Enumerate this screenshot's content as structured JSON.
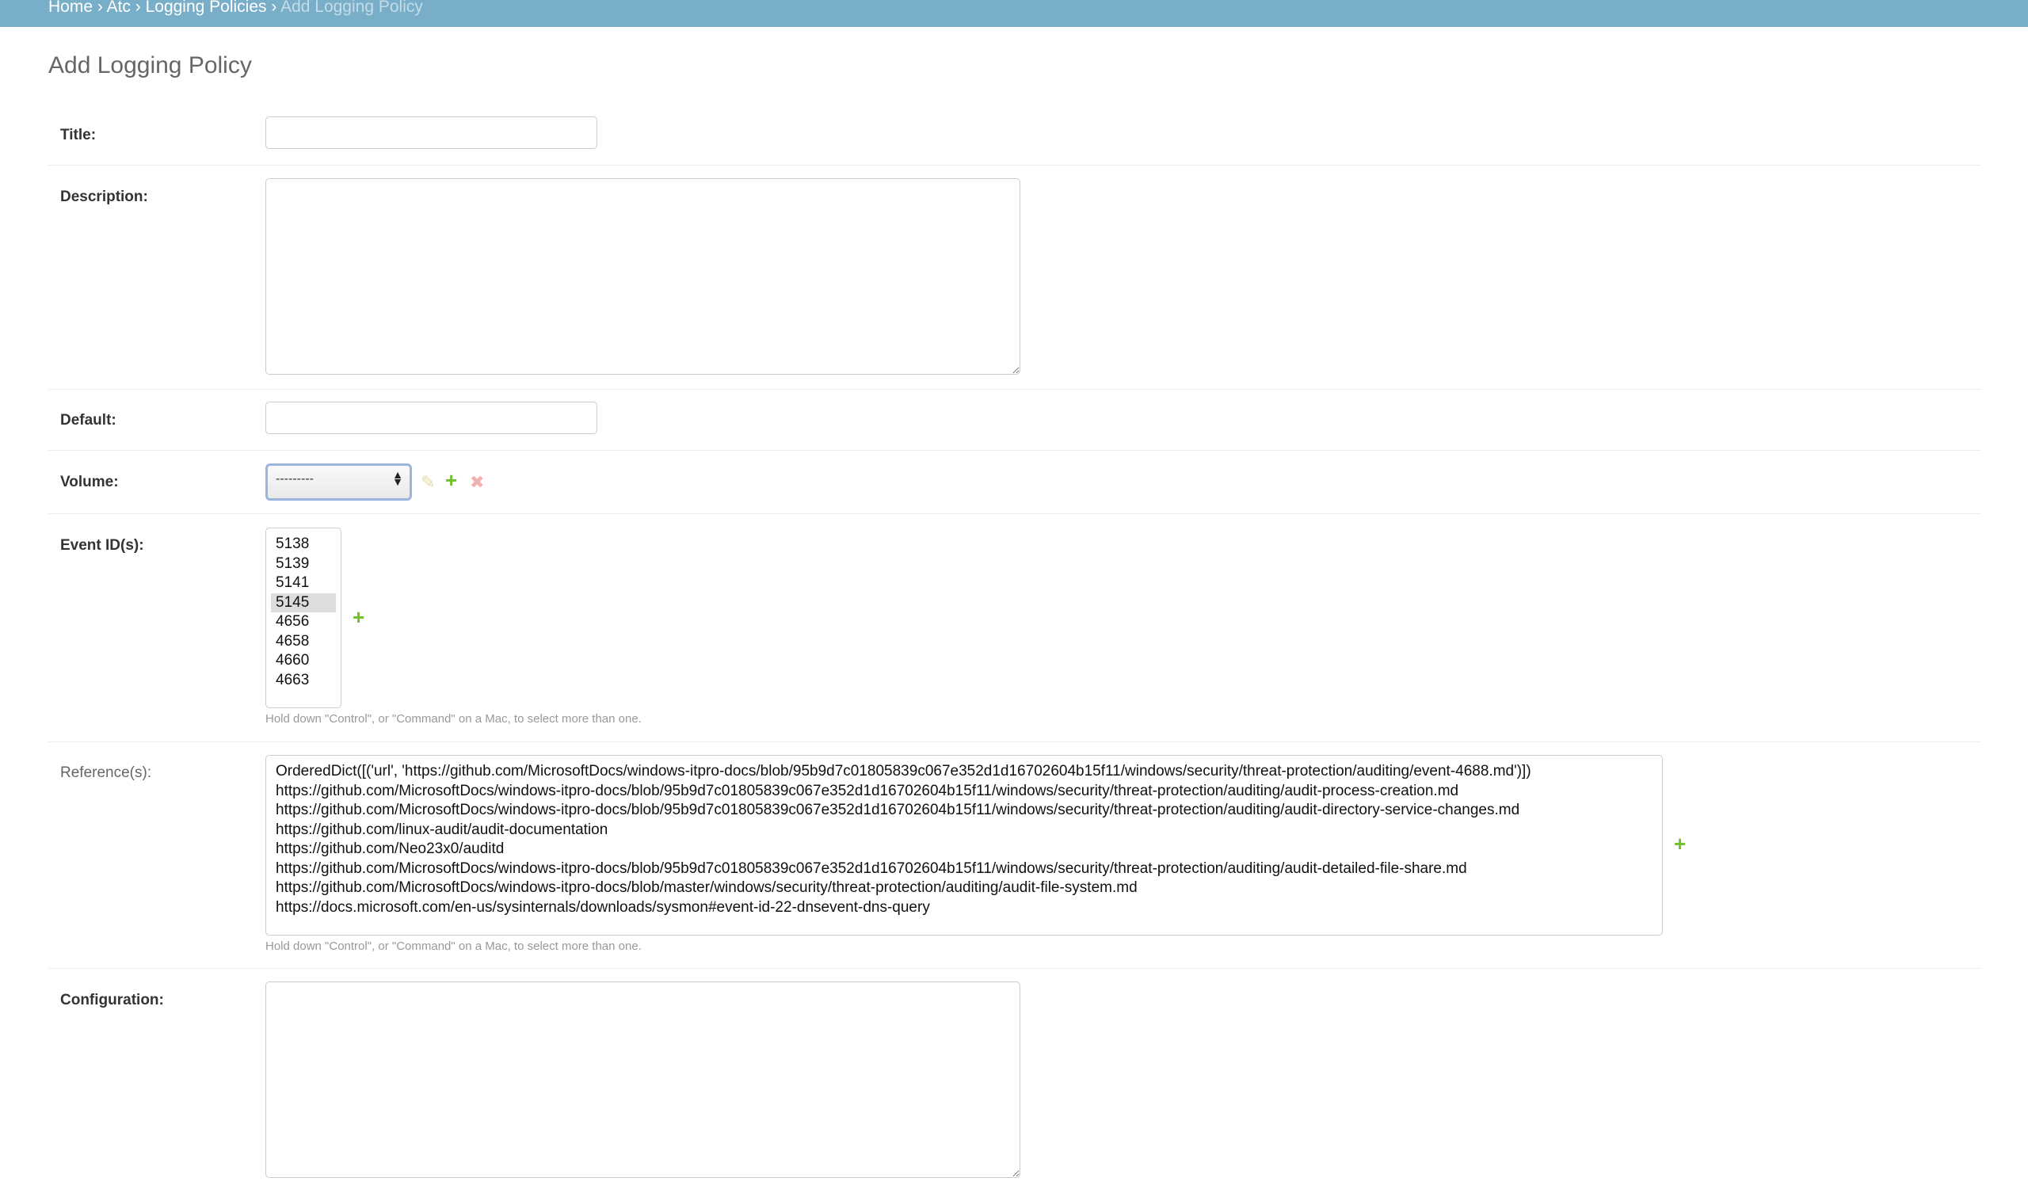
{
  "breadcrumbs": {
    "home": "Home",
    "app": "Atc",
    "model": "Logging Policies",
    "current": "Add Logging Policy",
    "separator": "›"
  },
  "page": {
    "title": "Add Logging Policy"
  },
  "form": {
    "title": {
      "label": "Title:",
      "value": ""
    },
    "description": {
      "label": "Description:",
      "value": ""
    },
    "default": {
      "label": "Default:",
      "value": ""
    },
    "volume": {
      "label": "Volume:",
      "selected": "---------"
    },
    "event_ids": {
      "label": "Event ID(s):",
      "options": [
        "5138",
        "5139",
        "5141",
        "5145",
        "4656",
        "4658",
        "4660",
        "4663"
      ],
      "selected": "5145",
      "help": "Hold down \"Control\", or \"Command\" on a Mac, to select more than one."
    },
    "references": {
      "label": "Reference(s):",
      "options": [
        "OrderedDict([('url', 'https://github.com/MicrosoftDocs/windows-itpro-docs/blob/95b9d7c01805839c067e352d1d16702604b15f11/windows/security/threat-protection/auditing/event-4688.md')])",
        "https://github.com/MicrosoftDocs/windows-itpro-docs/blob/95b9d7c01805839c067e352d1d16702604b15f11/windows/security/threat-protection/auditing/audit-process-creation.md",
        "https://github.com/MicrosoftDocs/windows-itpro-docs/blob/95b9d7c01805839c067e352d1d16702604b15f11/windows/security/threat-protection/auditing/audit-directory-service-changes.md",
        "https://github.com/linux-audit/audit-documentation",
        "https://github.com/Neo23x0/auditd",
        "https://github.com/MicrosoftDocs/windows-itpro-docs/blob/95b9d7c01805839c067e352d1d16702604b15f11/windows/security/threat-protection/auditing/audit-detailed-file-share.md",
        "https://github.com/MicrosoftDocs/windows-itpro-docs/blob/master/windows/security/threat-protection/auditing/audit-file-system.md",
        "https://docs.microsoft.com/en-us/sysinternals/downloads/sysmon#event-id-22-dnsevent-dns-query"
      ],
      "help": "Hold down \"Control\", or \"Command\" on a Mac, to select more than one."
    },
    "configuration": {
      "label": "Configuration:",
      "value": ""
    }
  },
  "icons": {
    "change": "pencil-icon",
    "add": "plus-icon",
    "delete": "cross-icon"
  },
  "colors": {
    "header_bg": "#79aec8",
    "add_icon": "#70bf2b",
    "change_icon": "#e4dc9e",
    "delete_icon": "#f0b0b0"
  }
}
